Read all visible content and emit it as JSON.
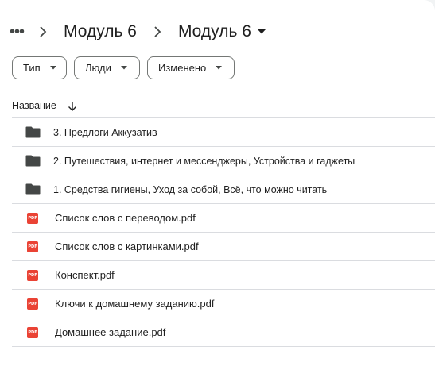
{
  "breadcrumb": {
    "more_label": "•••",
    "items": [
      {
        "label": "Модуль 6"
      },
      {
        "label": "Модуль 6"
      }
    ]
  },
  "filters": [
    {
      "label": "Тип"
    },
    {
      "label": "Люди"
    },
    {
      "label": "Изменено"
    }
  ],
  "list_header": {
    "name_label": "Название",
    "sort": "descending"
  },
  "items": [
    {
      "type": "folder",
      "name": "3. Предлоги Аккузатив"
    },
    {
      "type": "folder",
      "name": "2. Путешествия, интернет и мессенджеры, Устройства и гаджеты"
    },
    {
      "type": "folder",
      "name": "1. Средства гигиены, Уход за собой, Всё, что можно читать"
    },
    {
      "type": "pdf",
      "name": "Список слов с переводом.pdf"
    },
    {
      "type": "pdf",
      "name": "Список слов с картинками.pdf"
    },
    {
      "type": "pdf",
      "name": "Конспект.pdf"
    },
    {
      "type": "pdf",
      "name": "Ключи к домашнему заданию.pdf"
    },
    {
      "type": "pdf",
      "name": "Домашнее задание.pdf"
    }
  ],
  "icons": {
    "folder": "folder-icon",
    "pdf": "pdf-file-icon"
  },
  "pdf_badge": "PDF",
  "colors": {
    "folder": "#444746",
    "pdf": "#ea4335",
    "divider": "#dadce0",
    "chip_border": "#747775"
  }
}
